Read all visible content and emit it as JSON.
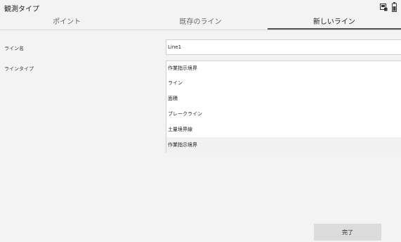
{
  "header": {
    "title": "観測タイプ",
    "icons": [
      "device-screen-icon",
      "battery-icon"
    ]
  },
  "tabs": [
    {
      "label": "ポイント",
      "active": false
    },
    {
      "label": "既存のライン",
      "active": false
    },
    {
      "label": "新しいライン",
      "active": true
    }
  ],
  "form": {
    "line_name_label": "ライン名",
    "line_name_value": "Line1",
    "line_type_label": "ラインタイプ",
    "line_type_value": "作業指示境界",
    "line_type_options": [
      "ライン",
      "面積",
      "ブレークライン",
      "土量境界線",
      "作業指示境界"
    ]
  },
  "footer": {
    "done_label": "完了"
  }
}
